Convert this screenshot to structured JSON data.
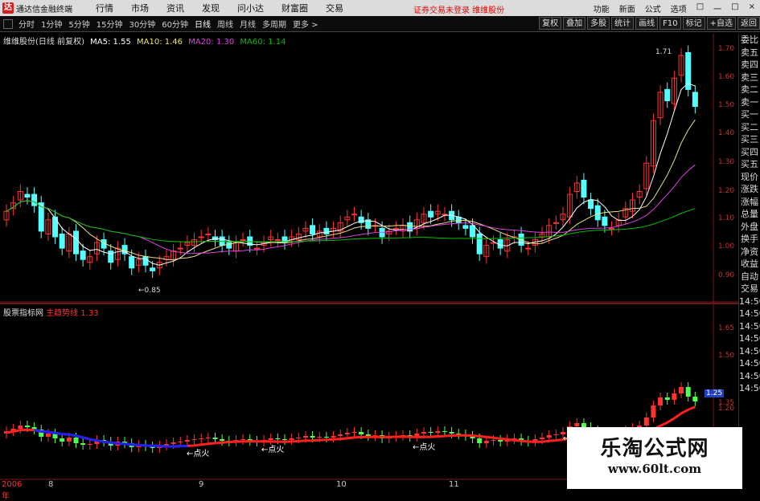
{
  "titlebar": {
    "logo": "达",
    "app": "通达信金融终端",
    "menus": [
      "行情",
      "市场",
      "资讯",
      "发现",
      "问小达",
      "财富圈",
      "交易"
    ],
    "notice": "证券交易未登录  维维股份",
    "right": [
      "功能",
      "新面",
      "公式",
      "选项",
      "□",
      "一",
      "□",
      "×"
    ]
  },
  "periods": [
    "分时",
    "1分钟",
    "5分钟",
    "15分钟",
    "30分钟",
    "60分钟",
    "日线",
    "周线",
    "月线",
    "多周期",
    "更多 >"
  ],
  "active_period": "日线",
  "toolbar_right": [
    "复权",
    "叠加",
    "多股",
    "统计",
    "画线",
    "F10",
    "标记",
    "+自选",
    "返回"
  ],
  "stock": {
    "title": "维维股份(日线 前复权)",
    "ma5": "MA5: 1.55",
    "ma10": "MA10: 1.46",
    "ma20": "MA20: 1.30",
    "ma60": "MA60: 1.14"
  },
  "sidebar": [
    "委比",
    "卖五",
    "卖四",
    "卖三",
    "卖二",
    "卖一",
    "买一",
    "买二",
    "买三",
    "买四",
    "买五",
    "现价",
    "涨跌",
    "涨幅",
    "总量",
    "外盘",
    "换手",
    "净资",
    "收益",
    "自动",
    "交易",
    "14:50",
    "14:50",
    "14:50",
    "14:50",
    "14:50",
    "14:50",
    "14:50",
    "14:50"
  ],
  "price_axis": [
    "1.70",
    "1.60",
    "1.50",
    "1.40",
    "1.30",
    "1.20",
    "1.10",
    "1.00",
    "0.90"
  ],
  "sub_axis": [
    "1.65",
    "1.50",
    "1.35",
    "1.25",
    "1.20"
  ],
  "sub_panel": {
    "name": "股票指标网",
    "line": "主趋势线",
    "value": "1.33"
  },
  "annotations": {
    "high": "1.71",
    "low": "←0.85",
    "fire": "←点火"
  },
  "dates": {
    "year": "2006年",
    "m8": "8",
    "m9": "9",
    "m10": "10",
    "m11": "11"
  },
  "watermark": {
    "line1": "乐淘公式网",
    "line2": "www.60lt.com"
  },
  "colors": {
    "up": "#ff3232",
    "down": "#54ffff",
    "ma5": "#ffffff",
    "ma10": "#e8e080",
    "ma20": "#e040e0",
    "ma60": "#00c000"
  }
}
